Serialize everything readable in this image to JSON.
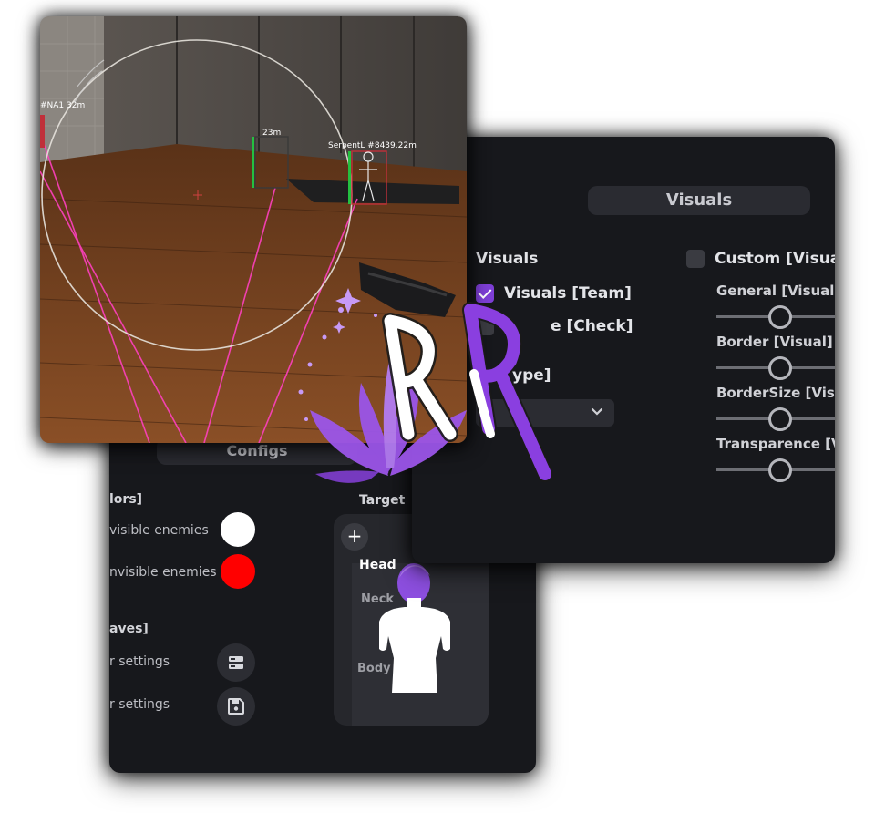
{
  "configs_panel": {
    "tab_label": "Configs",
    "colors_section": "lors]",
    "visible_label": "visible enemies",
    "invisible_label": "nvisible enemies",
    "visible_color": "#ffffff",
    "invisible_color": "#ff0000",
    "saves_section": "aves]",
    "load_label": "r settings",
    "save_label": "r settings",
    "target_title": "Target",
    "target_add": "+",
    "target_parts": [
      "Head",
      "Neck",
      "Body"
    ]
  },
  "visuals_panel": {
    "tab_label": "Visuals",
    "section_left": "Visuals",
    "team_label": "Visuals [Team]",
    "check_label": "e [Check]",
    "type_label": "ype]",
    "custom_label": "Custom [Visual",
    "sliders": [
      {
        "label": "General [Visual]",
        "value": 0.35
      },
      {
        "label": "Border [Visual]",
        "value": 0.35
      },
      {
        "label": "BorderSize [Visua",
        "value": 0.35
      },
      {
        "label": "Transparence [Vis",
        "value": 0.35
      }
    ],
    "accent_color": "#7e3fd6"
  },
  "game_view": {
    "esp_left": "#NA1 32m",
    "esp_middle": "23m",
    "esp_right": "SerpentL #8439.22m"
  },
  "icons": {
    "chevron": "chevron-down-icon",
    "load": "server-icon",
    "save": "floppy-disk-icon"
  }
}
